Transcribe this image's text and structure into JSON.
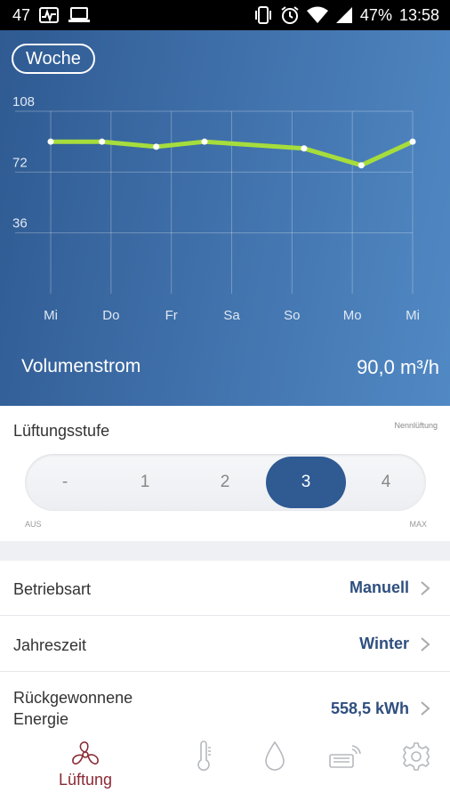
{
  "status_bar": {
    "notification_count": "47",
    "battery_percent": "47%",
    "time": "13:58",
    "icons": [
      "activity-icon",
      "laptop-icon",
      "vibrate-icon",
      "alarm-icon",
      "wifi-icon",
      "signal-icon",
      "battery-icon"
    ]
  },
  "header": {
    "range_button": "Woche",
    "metric_label": "Volumenstrom",
    "metric_value": "90,0 m³/h"
  },
  "chart_data": {
    "type": "line",
    "categories": [
      "Mi",
      "Do",
      "Fr",
      "Sa",
      "So",
      "Mo",
      "Mi"
    ],
    "x": [
      0,
      1,
      2,
      3,
      4,
      5,
      6
    ],
    "series": [
      {
        "points": [
          [
            0,
            90
          ],
          [
            0.85,
            90
          ],
          [
            1.75,
            87
          ],
          [
            2.55,
            90
          ],
          [
            4.2,
            86
          ],
          [
            5.15,
            76
          ],
          [
            6,
            90
          ]
        ]
      }
    ],
    "yticks": [
      36,
      72,
      108
    ],
    "ylim": [
      0,
      108
    ],
    "grid": true,
    "colors": {
      "line": "#a6dd3c",
      "point": "#ffffff",
      "grid": "#ffffff"
    }
  },
  "ventilation": {
    "title": "Lüftungsstufe",
    "hint": "Nennlüftung",
    "levels": [
      "-",
      "1",
      "2",
      "3",
      "4"
    ],
    "active_level": "3",
    "min_label": "AUS",
    "max_label": "MAX"
  },
  "settings": [
    {
      "label": "Betriebsart",
      "value": "Manuell"
    },
    {
      "label": "Jahreszeit",
      "value": "Winter"
    },
    {
      "label": "Rückgewonnene Energie",
      "value": "558,5 kWh"
    }
  ],
  "bottom_nav": {
    "active_label": "Lüftung",
    "items": [
      "fan-icon",
      "thermometer-icon",
      "drop-icon",
      "heater-icon",
      "gear-icon"
    ]
  },
  "colors": {
    "accent": "#2f5a92",
    "active_nav": "#8a2a35",
    "line": "#a6dd3c"
  }
}
